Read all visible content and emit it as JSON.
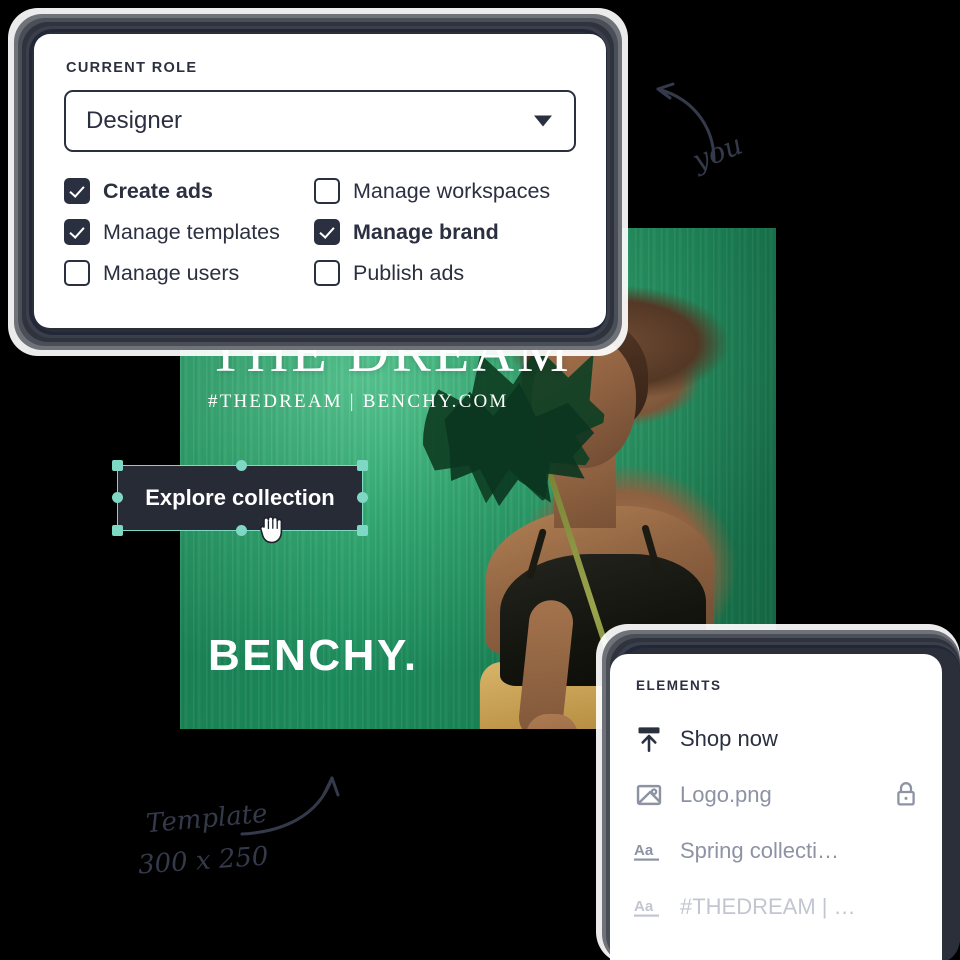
{
  "role_panel": {
    "section_label": "CURRENT ROLE",
    "select": {
      "name": "role-select",
      "value": "Designer",
      "caret_icon": "chevron-down-icon",
      "options": [
        "Designer"
      ]
    },
    "permissions": [
      {
        "label": "Create ads",
        "checked": true,
        "emphasized": true,
        "icon": "checkbox-checked-icon"
      },
      {
        "label": "Manage workspaces",
        "checked": false,
        "emphasized": false,
        "icon": "checkbox-unchecked-icon"
      },
      {
        "label": "Manage templates",
        "checked": true,
        "emphasized": false,
        "icon": "checkbox-checked-icon"
      },
      {
        "label": "Manage brand",
        "checked": true,
        "emphasized": true,
        "icon": "checkbox-checked-icon"
      },
      {
        "label": "Manage users",
        "checked": false,
        "emphasized": false,
        "icon": "checkbox-unchecked-icon"
      },
      {
        "label": "Publish ads",
        "checked": false,
        "emphasized": false,
        "icon": "checkbox-unchecked-icon"
      }
    ]
  },
  "elements_panel": {
    "section_label": "ELEMENTS",
    "items": [
      {
        "label": "Shop now",
        "icon": "button-element-icon",
        "state": "active",
        "locked": false,
        "lock_icon": ""
      },
      {
        "label": "Logo.png",
        "icon": "image-element-icon",
        "state": "muted",
        "locked": true,
        "lock_icon": "lock-icon"
      },
      {
        "label": "Spring collecti…",
        "icon": "text-element-icon",
        "state": "muted",
        "locked": false,
        "lock_icon": ""
      },
      {
        "label": "#THEDREAM | …",
        "icon": "text-element-icon",
        "state": "faded",
        "locked": false,
        "lock_icon": ""
      }
    ]
  },
  "banner": {
    "name": "ad-template-artboard",
    "title": "THE DREAM",
    "subtitle": "#THEDREAM | BENCHY.COM",
    "logo": "BENCHY.",
    "cta": {
      "label": "Explore collection",
      "selected": true,
      "cursor_icon": "grab-hand-cursor"
    }
  },
  "annotations": {
    "you": "you",
    "template_line1": "Template",
    "template_line2": "300 x 250"
  },
  "colors": {
    "ink": "#2b3040",
    "card_white": "#ffffff",
    "cta_dark": "#262b36",
    "selection_teal": "#7fd8c4",
    "brand_green": "#2aa36c",
    "muted_text": "#8d93a3",
    "faded_text": "#c2c6d1",
    "page_background": "#000000"
  }
}
